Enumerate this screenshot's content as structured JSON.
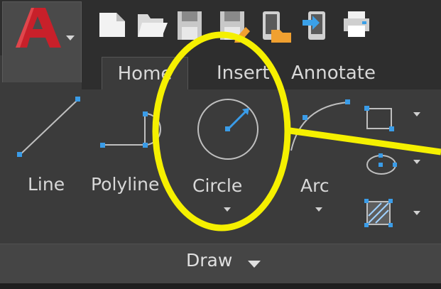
{
  "app": {
    "logo_letter": "A",
    "icons": [
      "app-logo-icon",
      "new-file-icon",
      "open-folder-icon",
      "save-icon",
      "save-as-icon",
      "open-from-web-icon",
      "save-to-web-icon",
      "print-icon"
    ]
  },
  "tabs": [
    {
      "label": "Home",
      "active": true
    },
    {
      "label": "Insert",
      "active": false
    },
    {
      "label": "Annotate",
      "active": false
    }
  ],
  "draw_panel": {
    "title": "Draw",
    "tools": {
      "line": "Line",
      "polyline": "Polyline",
      "circle": "Circle",
      "arc": "Arc"
    },
    "small_tools": [
      "rectangle-icon",
      "ellipse-icon",
      "hatch-icon"
    ]
  },
  "highlight": {
    "color": "#f5f000",
    "target": "Circle"
  },
  "colors": {
    "background": "#3b3b3b",
    "accent_red": "#c8202a",
    "grip_blue": "#3a9ce8",
    "text": "#d8d8d8"
  }
}
